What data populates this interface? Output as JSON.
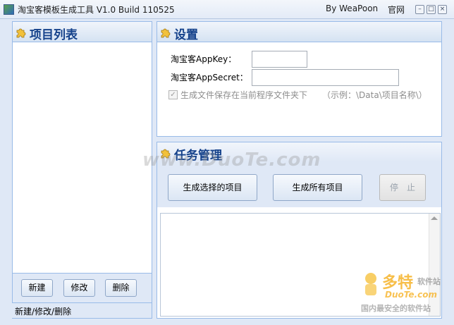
{
  "window": {
    "title": "淘宝客模板生成工具 V1.0 Build 110525",
    "byline": "By WeaPoon",
    "site_link": "官网",
    "controls": [
      "–",
      "□",
      "×"
    ]
  },
  "project_panel": {
    "title": "项目列表",
    "buttons": {
      "new": "新建",
      "edit": "修改",
      "delete": "删除"
    },
    "status": "新建/修改/删除"
  },
  "settings_panel": {
    "title": "设置",
    "appkey_label": "淘宝客AppKey：",
    "appkey_value": "",
    "appsecret_label": "淘宝客AppSecret：",
    "appsecret_value": "",
    "checkbox_label": "生成文件保存在当前程序文件夹下",
    "checkbox_hint": "（示例：\\Data\\项目名称\\）",
    "checkbox_checked": true
  },
  "task_panel": {
    "title": "任务管理",
    "generate_selected": "生成选择的项目",
    "generate_all": "生成所有项目",
    "stop": "停　止"
  },
  "watermark": "www.DuoTe.com",
  "logo": {
    "name": "多特",
    "tag": "软件站",
    "url": "DuoTe.com",
    "slogan": "国内最安全的软件站"
  }
}
